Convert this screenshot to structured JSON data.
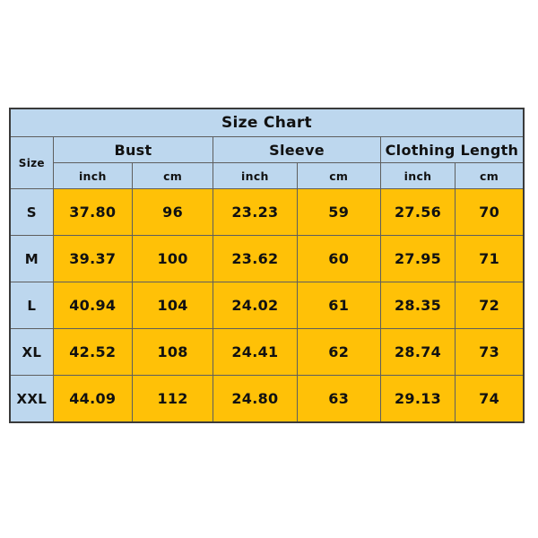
{
  "chart_data": {
    "type": "table",
    "title": "Size Chart",
    "size_column_header": "Size",
    "column_groups": [
      {
        "label": "Bust",
        "units": [
          "inch",
          "cm"
        ]
      },
      {
        "label": "Sleeve",
        "units": [
          "inch",
          "cm"
        ]
      },
      {
        "label": "Clothing Length",
        "units": [
          "inch",
          "cm"
        ]
      }
    ],
    "columns": [
      "Size",
      "Bust inch",
      "Bust cm",
      "Sleeve inch",
      "Sleeve cm",
      "Clothing Length inch",
      "Clothing Length cm"
    ],
    "rows": [
      {
        "size": "S",
        "bust_inch": "37.80",
        "bust_cm": "96",
        "sleeve_inch": "23.23",
        "sleeve_cm": "59",
        "length_inch": "27.56",
        "length_cm": "70"
      },
      {
        "size": "M",
        "bust_inch": "39.37",
        "bust_cm": "100",
        "sleeve_inch": "23.62",
        "sleeve_cm": "60",
        "length_inch": "27.95",
        "length_cm": "71"
      },
      {
        "size": "L",
        "bust_inch": "40.94",
        "bust_cm": "104",
        "sleeve_inch": "24.02",
        "sleeve_cm": "61",
        "length_inch": "28.35",
        "length_cm": "72"
      },
      {
        "size": "XL",
        "bust_inch": "42.52",
        "bust_cm": "108",
        "sleeve_inch": "24.41",
        "sleeve_cm": "62",
        "length_inch": "28.74",
        "length_cm": "73"
      },
      {
        "size": "XXL",
        "bust_inch": "44.09",
        "bust_cm": "112",
        "sleeve_inch": "24.80",
        "sleeve_cm": "63",
        "length_inch": "29.13",
        "length_cm": "74"
      }
    ],
    "colors": {
      "header_background": "#BDD7EE",
      "data_background": "#FFC107",
      "border": "#5E5E5E",
      "outer_border": "#3A3A3A",
      "text": "#111111",
      "page_background": "#FFFFFF"
    }
  }
}
